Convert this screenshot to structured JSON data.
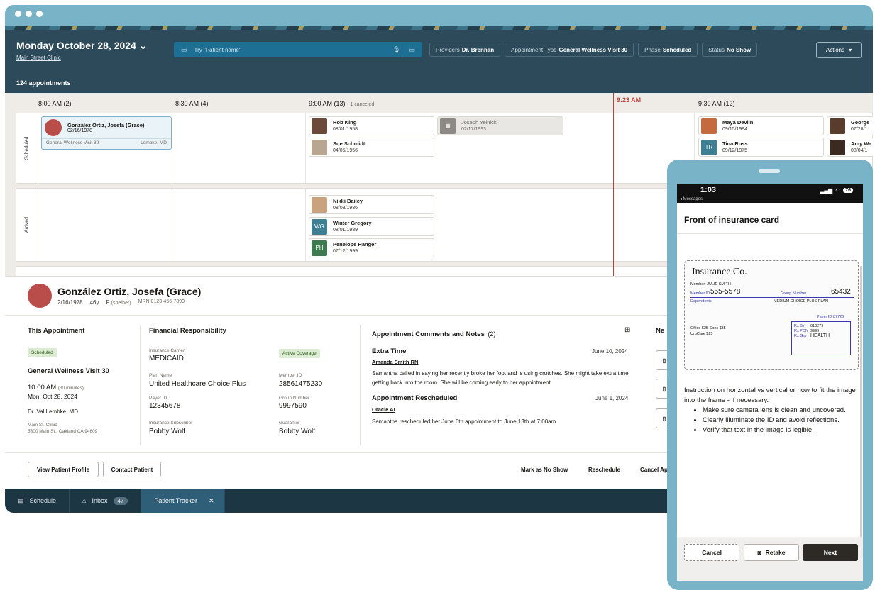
{
  "header": {
    "date": "Monday October 28, 2024",
    "clinic": "Main Street Clinic",
    "search_placeholder": "Try \"Patient name\"",
    "filters": [
      {
        "label": "Providers",
        "value": "Dr. Brennan"
      },
      {
        "label": "Appointment Type",
        "value": "General Wellness Visit 30"
      },
      {
        "label": "Phase",
        "value": "Scheduled"
      },
      {
        "label": "Status",
        "value": "No Show"
      }
    ],
    "actions_label": "Actions",
    "appointment_count": "124 appointments"
  },
  "timeline": {
    "slots": [
      {
        "time": "8:00 AM",
        "count": "(2)",
        "extra": ""
      },
      {
        "time": "8:30 AM",
        "count": "(4)",
        "extra": ""
      },
      {
        "time": "9:00 AM",
        "count": "(13)",
        "extra": "• 1 canceled"
      },
      {
        "time": "9:30 AM",
        "count": "(12)",
        "extra": ""
      }
    ],
    "now_label": "9:23 AM",
    "rows": [
      "Scheduled",
      "Arrived"
    ],
    "selected_card": {
      "name": "González Ortiz, Josefa (Grace)",
      "dob": "02/16/1978",
      "type": "General Wellness Visit 30",
      "provider": "Lembke, MD"
    },
    "scheduled_900": [
      {
        "name": "Rob King",
        "dob": "08/01/1958"
      },
      {
        "name": "Sue Schmidt",
        "dob": "04/05/1956"
      }
    ],
    "canceled_card": {
      "name": "Joseph Yelnick",
      "dob": "02/17/1993"
    },
    "scheduled_930": [
      {
        "name": "Maya Devlin",
        "dob": "09/15/1994",
        "initials": ""
      },
      {
        "name": "Tina Ross",
        "dob": "09/12/1975",
        "initials": "TR"
      },
      {
        "name": "George",
        "dob": "07/28/1"
      },
      {
        "name": "Amy Wa",
        "dob": "08/04/1"
      }
    ],
    "arrived_900": [
      {
        "name": "Nikki Bailey",
        "dob": "08/08/1986",
        "initials": ""
      },
      {
        "name": "Winter Gregory",
        "dob": "08/01/1989",
        "initials": "WG"
      },
      {
        "name": "Penelope Hanger",
        "dob": "07/12/1999",
        "initials": "PH"
      }
    ]
  },
  "patient": {
    "name": "González Ortiz, Josefa (Grace)",
    "dob": "2/16/1978",
    "age": "46y",
    "gender": "F",
    "pronouns": "(she/her)",
    "mrn": "MRN 0123-456-7890"
  },
  "this_appointment": {
    "title": "This Appointment",
    "status": "Scheduled",
    "type": "General Wellness Visit 30",
    "time": "10:00 AM",
    "duration": "(30 minutes)",
    "date": "Mon, Oct 28, 2024",
    "provider": "Dr. Val Lembke, MD",
    "location": "Main St. Clinic",
    "address": "5300 Main St., Oakland CA 94609"
  },
  "financial": {
    "title": "Financial Responsibility",
    "carrier_label": "Insurance Carrier",
    "carrier": "MEDICAID",
    "coverage": "Active Coverage",
    "plan_label": "Plan Name",
    "plan": "United Healthcare Choice Plus",
    "member_label": "Member ID",
    "member": "28561475230",
    "payer_label": "Payer ID",
    "payer": "12345678",
    "group_label": "Group Number",
    "group": "9997590",
    "subscriber_label": "Insurance Subscriber",
    "subscriber": "Bobby Wolf",
    "guarantor_label": "Guarantor",
    "guarantor": "Bobby Wolf"
  },
  "notes": {
    "title": "Appointment Comments and Notes",
    "count": "(2)",
    "items": [
      {
        "title": "Extra Time",
        "date": "June 10, 2024",
        "author": "Amanda Smith RN",
        "text": "Samantha called in saying her recently broke her foot and is using crutches. She might take extra time getting back into the room. She will be coming early to her appointment"
      },
      {
        "title": "Appointment Rescheduled",
        "date": "June 1, 2024",
        "author": "Oracle AI",
        "text": "Samantha rescheduled her June 6th appointment to June 13th at 7:00am"
      }
    ],
    "next_col": "Ne"
  },
  "footer_actions": {
    "view_profile": "View Patient Profile",
    "contact": "Contact Patient",
    "no_show": "Mark as No Show",
    "reschedule": "Reschedule",
    "cancel": "Cancel Ap"
  },
  "bottom_nav": {
    "schedule": "Schedule",
    "inbox": "Inbox",
    "inbox_count": "47",
    "tracker": "Patient Tracker"
  },
  "phone": {
    "time": "1:03",
    "back": "◂ Messages",
    "battery": "76",
    "title": "Front of insurance card",
    "card": {
      "logo": "Insurance Co.",
      "member": "Member: JULIE SMITH",
      "member_id_label": "Member ID",
      "member_id": "555-5578",
      "group_label": "Group Number",
      "group": "65432",
      "plan": "MEDIUM CHOICE PLUS PLAN",
      "dependents": "Dependents",
      "payer_id": "Payer ID 87726",
      "copay": "Office $25   Spec $35",
      "copay2": "UrgCare $25",
      "rx_bin": "Rx Bin",
      "rx_bin_val": "610279",
      "rx_pcn": "Rx PCN",
      "rx_pcn_val": "9999",
      "rx_grp": "Rx Grp",
      "rx_grp_val": "HEALTH"
    },
    "instructions": "Instruction on horizontal vs vertical or how to fit the image into the frame - if necessary.",
    "bullets": [
      "Make sure camera lens is clean and uncovered.",
      "Clearly illuminate the ID and avoid reflections.",
      "Verify that text in the image is legible."
    ],
    "cancel": "Cancel",
    "retake": "Retake",
    "next": "Next"
  }
}
